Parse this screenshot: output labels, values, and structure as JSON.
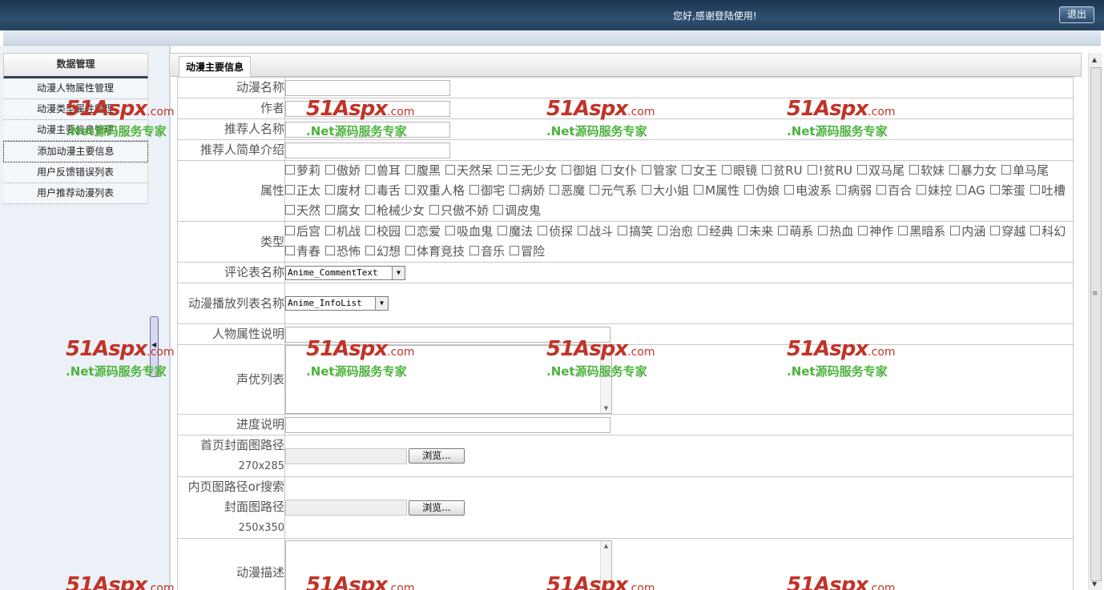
{
  "header": {
    "greeting": "您好,感谢登陆使用!",
    "logout_label": "退出"
  },
  "sidebar": {
    "title": "数据管理",
    "items": [
      {
        "label": "动漫人物属性管理"
      },
      {
        "label": "动漫类型属性管理"
      },
      {
        "label": "动漫主要信息管理"
      },
      {
        "label": "添加动漫主要信息"
      },
      {
        "label": "用户反馈错误列表"
      },
      {
        "label": "用户推荐动漫列表"
      }
    ]
  },
  "main": {
    "tab_label": "动漫主要信息",
    "fields": {
      "name": {
        "label": "动漫名称",
        "value": ""
      },
      "author": {
        "label": "作者",
        "value": ""
      },
      "recommender": {
        "label": "推荐人名称",
        "value": ""
      },
      "recommender_intro": {
        "label": "推荐人简单介绍",
        "value": ""
      },
      "attributes": {
        "label": "属性",
        "options": [
          "萝莉",
          "傲娇",
          "兽耳",
          "腹黑",
          "天然呆",
          "三无少女",
          "御姐",
          "女仆",
          "管家",
          "女王",
          "眼镜",
          "贫RU",
          "!贫RU",
          "双马尾",
          "软妹",
          "暴力女",
          "单马尾",
          "正太",
          "废材",
          "毒舌",
          "双重人格",
          "御宅",
          "病娇",
          "恶魔",
          "元气系",
          "大小姐",
          "M属性",
          "伪娘",
          "电波系",
          "病弱",
          "百合",
          "妹控",
          "AG",
          "笨蛋",
          "吐槽",
          "天然",
          "腐女",
          "枪械少女",
          "只傲不娇",
          "调皮鬼"
        ]
      },
      "types": {
        "label": "类型",
        "options": [
          "后宫",
          "机战",
          "校园",
          "恋爱",
          "吸血鬼",
          "魔法",
          "侦探",
          "战斗",
          "搞笑",
          "治愈",
          "经典",
          "未来",
          "萌系",
          "热血",
          "神作",
          "黑暗系",
          "内涵",
          "穿越",
          "科幻",
          "青春",
          "恐怖",
          "幻想",
          "体育竞技",
          "音乐",
          "冒险"
        ]
      },
      "comment_table": {
        "label": "评论表名称",
        "selected": "Anime_CommentText"
      },
      "playlist_table": {
        "label": "动漫播放列表名称",
        "selected": "Anime_InfoList"
      },
      "char_attr_desc": {
        "label": "人物属性说明",
        "value": ""
      },
      "voice_actors": {
        "label": "声优列表",
        "value": ""
      },
      "progress": {
        "label": "进度说明",
        "value": ""
      },
      "home_cover": {
        "label": "首页封面图路径",
        "size": "270x285",
        "browse_label": "浏览..."
      },
      "inner_cover": {
        "label": "内页图路径or搜索封面图路径",
        "size": "250x350",
        "browse_label": "浏览..."
      },
      "description": {
        "label": "动漫描述",
        "value": ""
      }
    }
  },
  "watermark": {
    "logo": "51Aspx",
    "logo_suffix": ".com",
    "slogan": ".Net源码服务专家"
  },
  "colors": {
    "header_bg": "#24425f",
    "watermark_red": "#c03427",
    "watermark_green": "#4db33d"
  }
}
